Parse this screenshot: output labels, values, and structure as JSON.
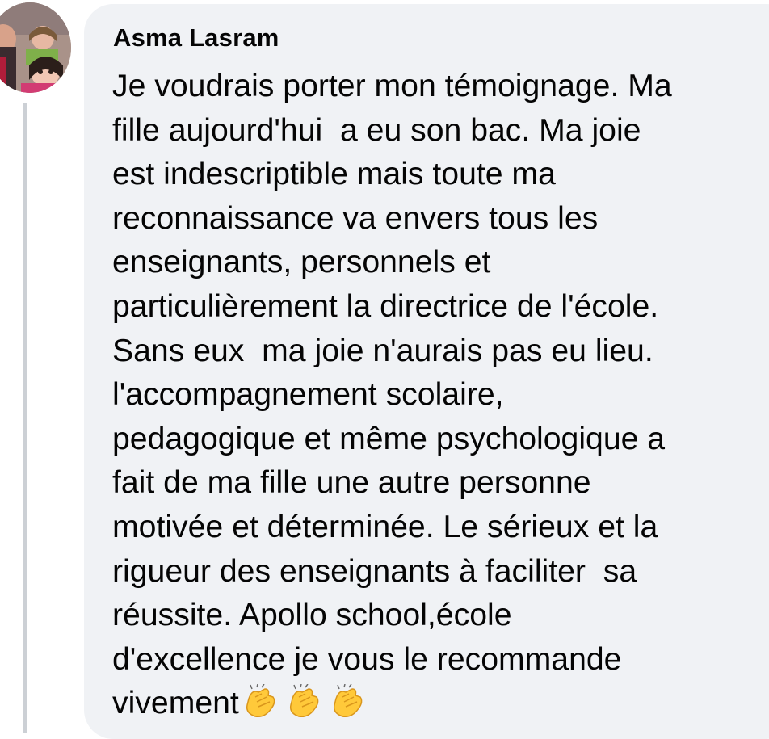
{
  "comment": {
    "author": "Asma Lasram",
    "lines": [
      "Je voudrais porter mon témoignage. Ma",
      "fille aujourd'hui  a eu son bac. Ma joie",
      "est indescriptible mais toute ma",
      "reconnaissance va envers tous les",
      "enseignants, personnels et",
      "particulièrement la directrice de l'école.",
      "Sans eux  ma joie n'aurais pas eu lieu.",
      "l'accompagnement scolaire,",
      "pedagogique et même psychologique a",
      "fait de ma fille une autre personne",
      "motivée et déterminée. Le sérieux et la",
      "rigueur des enseignants à faciliter  sa",
      "réussite. Apollo school,école",
      "d'excellence je vous le recommande",
      "vivement"
    ],
    "emoji": [
      "clapping-hands",
      "clapping-hands",
      "clapping-hands"
    ]
  },
  "colors": {
    "bubble": "#f0f2f5",
    "text": "#050505",
    "thread_line": "#ccd0d5",
    "emoji": "#ffc93a"
  }
}
